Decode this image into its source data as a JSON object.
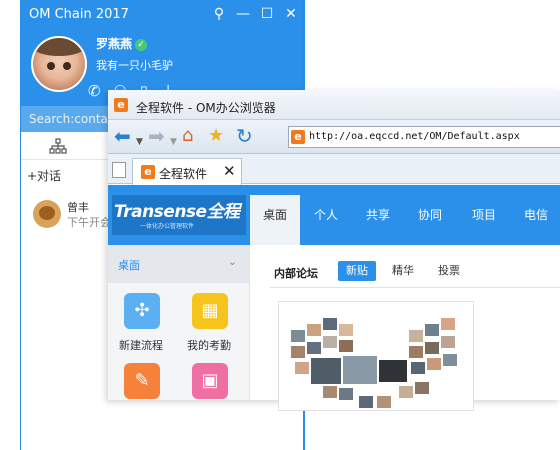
{
  "om": {
    "title": "OM Chain 2017",
    "controls": {
      "pin": "⚲",
      "minimize": "—",
      "maximize": "☐",
      "close": "✕"
    },
    "user": {
      "name": "罗燕燕",
      "signature": "我有一只小毛驴"
    },
    "search": {
      "placeholder": "Search:contact"
    },
    "add_chat": "+对话",
    "contacts": [
      {
        "name": "曾丰",
        "message": "下午开会"
      }
    ],
    "colors": {
      "accent": "#2b90ea"
    }
  },
  "browser": {
    "title": "全程软件 - OM办公浏览器",
    "address": "http://oa.eqccd.net/OM/Default.aspx",
    "tab": {
      "label": "全程软件",
      "close": "✕"
    }
  },
  "app": {
    "logo": {
      "text": "Transense全程",
      "tagline": "一体化办公管理软件"
    },
    "nav": [
      "桌面",
      "个人",
      "共享",
      "协同",
      "项目",
      "电信"
    ],
    "sidebar": {
      "title": "桌面",
      "apps": [
        {
          "label": "新建流程",
          "icon": "flow-icon",
          "color": "#5ab0f0"
        },
        {
          "label": "我的考勤",
          "icon": "attendance-icon",
          "color": "#f5c51e"
        },
        {
          "label": "",
          "icon": "edit-icon",
          "color": "#f5813b"
        },
        {
          "label": "",
          "icon": "box-icon",
          "color": "#f06fa3"
        }
      ]
    },
    "forum": {
      "title": "内部论坛",
      "tabs": [
        "新贴",
        "精华",
        "投票"
      ],
      "active_tab": "新贴"
    }
  }
}
